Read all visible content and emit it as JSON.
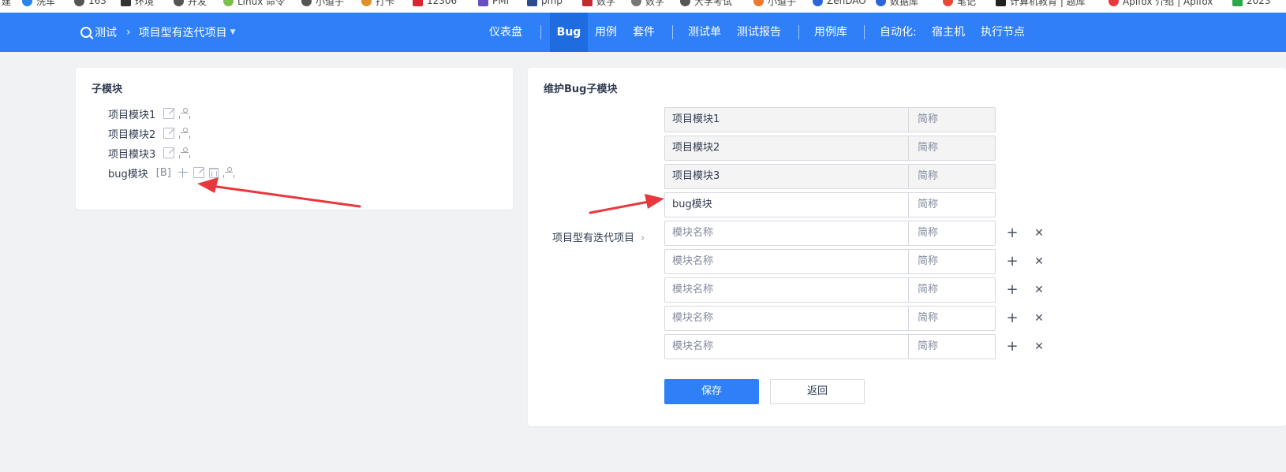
{
  "bookmarks": [
    "建",
    "洗车",
    "163",
    "环境",
    "开发",
    "Linux 命令",
    "小道子",
    "打卡",
    "12306",
    "PMI",
    "pmp",
    "数字",
    "数字",
    "大学考试",
    "小道子",
    "ZenDAO",
    "数据库",
    "笔记",
    "计算机教育 | 题库",
    "Apifox 介绍 | Apifox",
    "2023"
  ],
  "header": {
    "product": "测试",
    "project": "项目型有迭代项目",
    "nav": [
      "仪表盘",
      "Bug",
      "用例",
      "套件",
      "测试单",
      "测试报告",
      "用例库",
      "自动化:",
      "宿主机",
      "执行节点"
    ],
    "active": "Bug"
  },
  "left": {
    "title": "子模块",
    "modules": [
      {
        "name": "项目模块1",
        "tag": ""
      },
      {
        "name": "项目模块2",
        "tag": ""
      },
      {
        "name": "项目模块3",
        "tag": ""
      },
      {
        "name": "bug模块",
        "tag": "[B]"
      }
    ]
  },
  "right": {
    "title": "维护Bug子模块",
    "parent": "项目型有迭代项目",
    "existing": [
      {
        "name": "项目模块1",
        "short_placeholder": "简称"
      },
      {
        "name": "项目模块2",
        "short_placeholder": "简称"
      },
      {
        "name": "项目模块3",
        "short_placeholder": "简称"
      },
      {
        "name": "bug模块",
        "short_placeholder": "简称"
      }
    ],
    "new_rows": [
      {
        "name_placeholder": "模块名称",
        "short_placeholder": "简称"
      },
      {
        "name_placeholder": "模块名称",
        "short_placeholder": "简称"
      },
      {
        "name_placeholder": "模块名称",
        "short_placeholder": "简称"
      },
      {
        "name_placeholder": "模块名称",
        "short_placeholder": "简称"
      },
      {
        "name_placeholder": "模块名称",
        "short_placeholder": "简称"
      }
    ],
    "add_symbol": "+",
    "remove_symbol": "✕",
    "save_label": "保存",
    "back_label": "返回"
  },
  "colors": {
    "primary": "#2e7ff8",
    "annotation_arrow": "#e8383d"
  }
}
